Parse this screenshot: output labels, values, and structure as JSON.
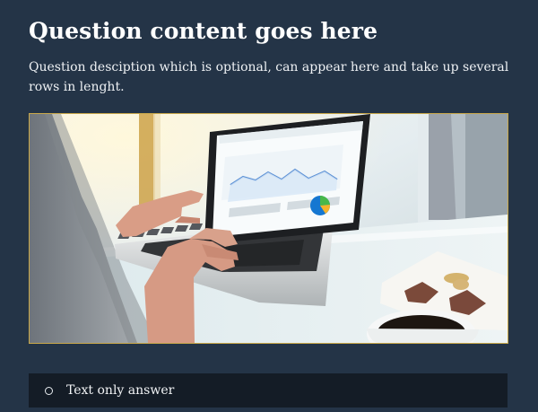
{
  "question": {
    "title": "Question content goes here",
    "description": "Question desciption which is optional, can appear here and take up several rows in lenght."
  },
  "image": {
    "subject": "laptop-analytics-photo"
  },
  "answers": [
    {
      "label": "Text only answer",
      "selected": false
    }
  ],
  "colors": {
    "background": "#243447",
    "image_border": "#c9a84a",
    "answer_background": "#141c26",
    "text": "#ffffff"
  }
}
